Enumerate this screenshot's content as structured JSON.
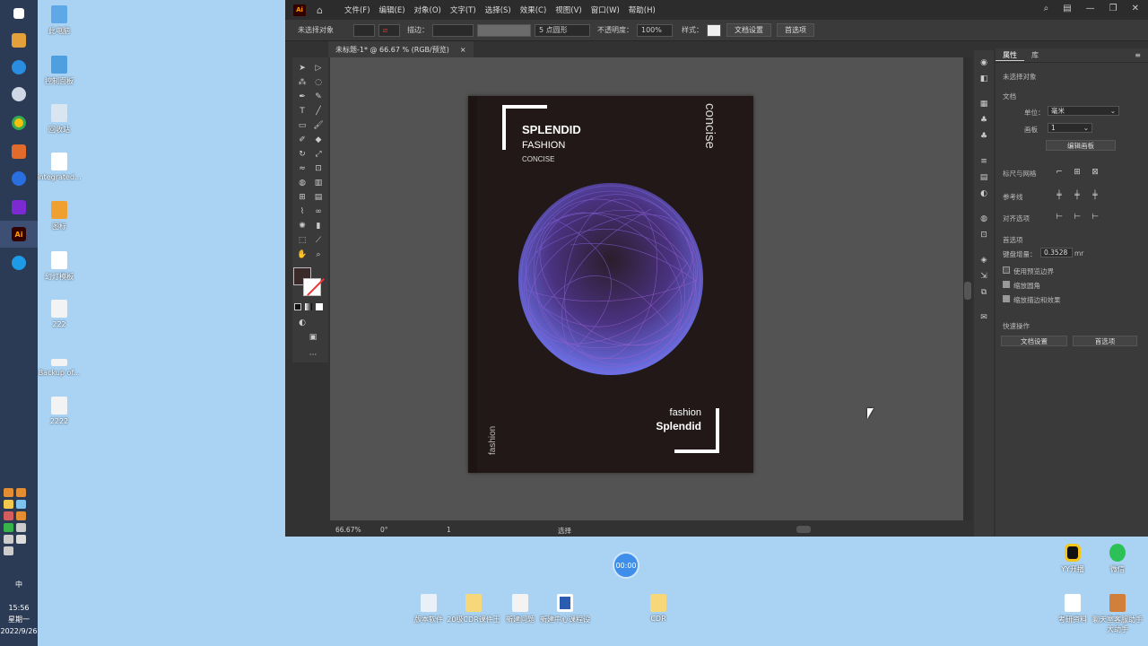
{
  "taskbar": {
    "icons": [
      "windows-start",
      "pen-app",
      "browser",
      "settings-gear",
      "chrome",
      "mascot",
      "task-check",
      "cloud-app",
      "illustrator",
      "edge"
    ],
    "clock_time": "15:56",
    "clock_day": "星期一",
    "clock_date": "2022/9/26",
    "ime": "中"
  },
  "desktop": {
    "icons": [
      {
        "label": "此电脑"
      },
      {
        "label": "控制面板"
      },
      {
        "label": "回收站"
      },
      {
        "label": "integrated..."
      },
      {
        "label": "图标"
      },
      {
        "label": "幻灯模板"
      },
      {
        "label": "222"
      },
      {
        "label": "Backup of..."
      },
      {
        "label": "2222"
      }
    ],
    "bottom_icons": [
      {
        "label": "版本软件"
      },
      {
        "label": "20级CDR课件王"
      },
      {
        "label": "新建问题"
      },
      {
        "label": "新建中心课程设"
      },
      {
        "label": "CDR"
      },
      {
        "label": "YY开播"
      },
      {
        "label": "微信"
      },
      {
        "label": "考研资料"
      },
      {
        "label": "聊天室客服助手大助手"
      }
    ],
    "timer": "00:00"
  },
  "ai": {
    "logo": "Ai",
    "menu": [
      "文件(F)",
      "编辑(E)",
      "对象(O)",
      "文字(T)",
      "选择(S)",
      "效果(C)",
      "视图(V)",
      "窗口(W)",
      "帮助(H)"
    ],
    "control": {
      "no_selection": "未选择对象",
      "stroke_label": "描边：",
      "brush": "5 点圆形",
      "opacity_label": "不透明度：",
      "opacity_value": "100%",
      "style_label": "样式：",
      "doc_setup": "文档设置",
      "prefs": "首选项"
    },
    "tab": {
      "title": "未标题-1* @ 66.67 % (RGB/预览)",
      "close": "×"
    },
    "artboard": {
      "title": "SPLENDID",
      "subtitle": "FASHION",
      "small": "CONCISE",
      "vertical_right": "concise",
      "vertical_left": "fashion",
      "bottom_line1": "fashion",
      "bottom_line2": "Splendid"
    },
    "status": {
      "zoom": "66.67%",
      "rotate": "0°",
      "artboard_no": "1",
      "mode": "选择"
    },
    "panel": {
      "tab_props": "属性",
      "tab_lib": "库",
      "no_selection": "未选择对象",
      "doc_section": "文档",
      "unit_label": "单位：",
      "unit_value": "毫米",
      "artboard_label": "画板",
      "artboard_value": "1",
      "edit_artboard": "编辑画板",
      "rulers_grids": "标尺与网格",
      "guides": "参考线",
      "snap": "对齐选项",
      "prefs_section": "首选项",
      "key_increment_label": "键盘增量：",
      "key_increment_value": "0.3528",
      "key_increment_unit": "mr",
      "preview_bounds": "使用预览边界",
      "scale_corners": "缩放圆角",
      "scale_strokes": "缩放描边和效果",
      "quick_actions": "快速操作",
      "doc_setup_btn": "文档设置",
      "prefs_btn": "首选项"
    }
  }
}
